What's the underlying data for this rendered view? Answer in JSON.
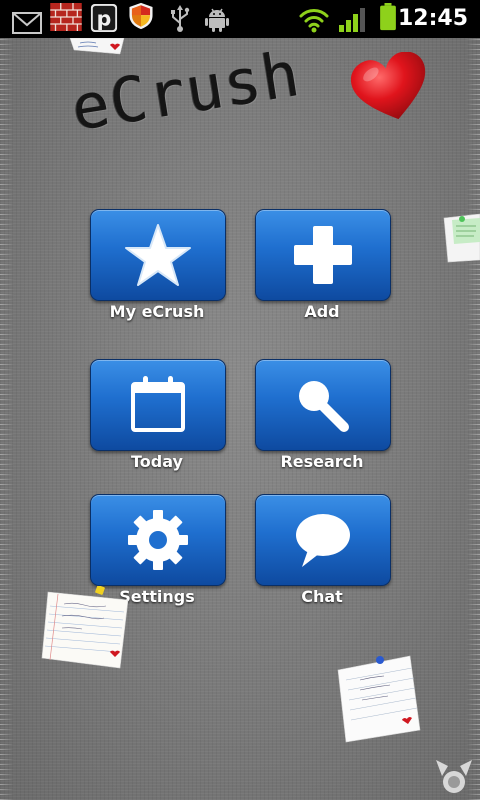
{
  "status_bar": {
    "time": "12:45",
    "icons": [
      "gmail-icon",
      "firewall-icon",
      "parking-icon",
      "shield-icon",
      "usb-icon",
      "android-debug-icon",
      "wifi-icon",
      "signal-icon",
      "battery-icon"
    ]
  },
  "app": {
    "logo_text": "eCrush",
    "menu": [
      {
        "label": "My eCrush",
        "icon": "star-icon"
      },
      {
        "label": "Add",
        "icon": "plus-icon"
      },
      {
        "label": "Today",
        "icon": "calendar-icon"
      },
      {
        "label": "Research",
        "icon": "magnifier-icon"
      },
      {
        "label": "Settings",
        "icon": "gear-icon"
      },
      {
        "label": "Chat",
        "icon": "speech-bubble-icon"
      }
    ]
  },
  "colors": {
    "tile_top": "#3b8fe6",
    "tile_bottom": "#0e4aa0",
    "heart": "#e0141c",
    "status_green": "#8ed11b"
  }
}
